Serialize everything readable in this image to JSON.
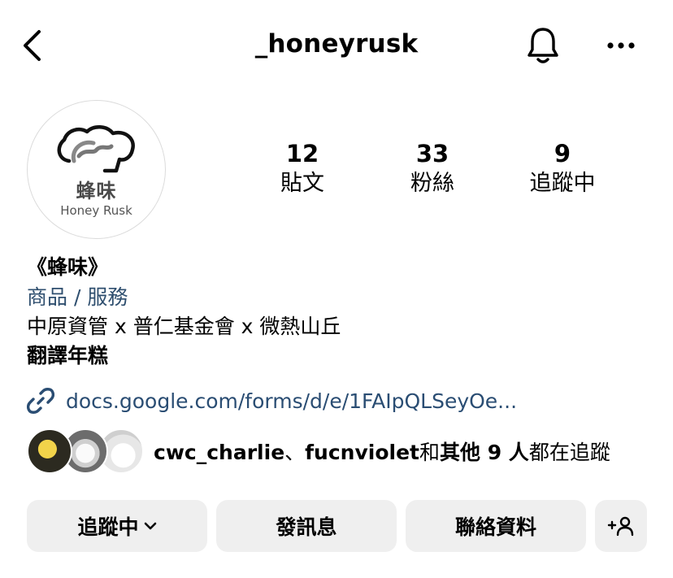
{
  "header": {
    "username": "_honeyrusk",
    "back_icon": "chevron-left-icon",
    "bell_icon": "bell-icon",
    "more_icon": "more-horizontal-icon"
  },
  "avatar": {
    "logo_cn": "蜂味",
    "logo_en": "Honey Rusk"
  },
  "stats": {
    "posts": {
      "value": "12",
      "label": "貼文"
    },
    "followers": {
      "value": "33",
      "label": "粉絲"
    },
    "following": {
      "value": "9",
      "label": "追蹤中"
    }
  },
  "bio": {
    "name": "《蜂味》",
    "category": "商品 / 服務",
    "line1": "中原資管 x 普仁基金會 x 微熱山丘",
    "line2": "翻譯年糕"
  },
  "link": {
    "text": "docs.google.com/forms/d/e/1FAIpQLSeyOe...",
    "icon": "link-icon"
  },
  "mutual": {
    "user1": "cwc_charlie",
    "sep": "、",
    "user2": "fucnviolet",
    "mid": "和",
    "others": "其他 9 人",
    "tail": "都在追蹤"
  },
  "actions": {
    "follow_label": "追蹤中",
    "message_label": "發訊息",
    "contact_label": "聯絡資料",
    "add_icon": "add-person-icon"
  },
  "colors": {
    "link": "#2a4d73",
    "category": "#2f4f6f",
    "button_bg": "#efefef"
  }
}
